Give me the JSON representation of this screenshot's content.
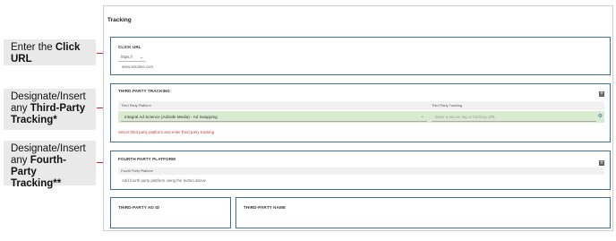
{
  "callouts": [
    {
      "prefix": "Enter the ",
      "bold": "Click URL",
      "suffix": ""
    },
    {
      "prefix": "Designate/Insert any ",
      "bold": "Third-Party Tracking*",
      "suffix": ""
    },
    {
      "prefix": "Designate/Insert any ",
      "bold": "Fourth-Party Tracking**",
      "suffix": ""
    }
  ],
  "page": {
    "title": "Tracking"
  },
  "click_url": {
    "title": "CLICK URL",
    "protocol": "https://",
    "value": "www.amobee.com"
  },
  "third_party": {
    "title": "THIRD PARTY TRACKING",
    "col_platform": "Third Party Platform",
    "col_tracking": "Third Party Tracking",
    "platform_value": "Integral Ad Science (AdSafe Media) - Ad Swapping",
    "tracking_placeholder": "Enter a secure tag or tracking URL",
    "warning": "Select third party platform and enter third party tracking"
  },
  "fourth_party": {
    "title": "FOURTH PARTY PLATFORM",
    "col_platform": "Fourth Party Platform",
    "info": "Add fourth party platform using the button above."
  },
  "third_party_ad_id": {
    "title": "THIRD-PARTY AD ID"
  },
  "third_party_name": {
    "title": "THIRD-PARTY NAME"
  },
  "icons": {
    "add": "plus-icon",
    "settings": "gear-icon",
    "dropdown": "chevron-down-icon"
  },
  "colors": {
    "panel_border": "#3d6fa8",
    "arrow": "#e01b1b",
    "selected_row": "#d9ecd2",
    "warning_text": "#d43a2a"
  }
}
